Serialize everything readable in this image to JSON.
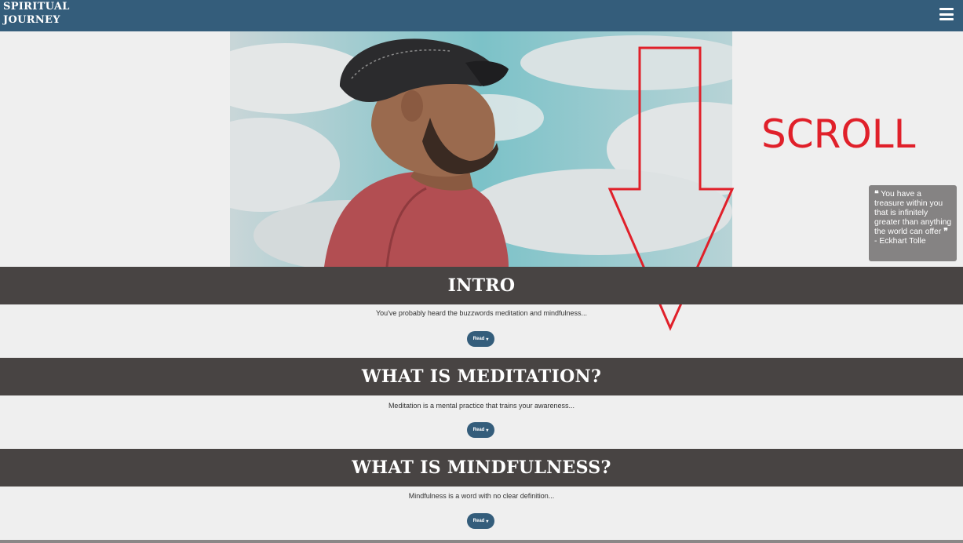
{
  "navbar": {
    "brand_line1": "SPIRITUAL",
    "brand_line2": "JOURNEY",
    "menu_icon": "hamburger-menu-icon",
    "background_color": "#345d7b"
  },
  "annotation": {
    "scroll_text": "SCROLL",
    "arrow_color": "#e0202a"
  },
  "quote": {
    "open_mark": "❝",
    "text": "You have a treasure within you that is infinitely greater than anything the world can offer",
    "close_mark": "❞",
    "author": "- Eckhart Tolle"
  },
  "sections": [
    {
      "title": "INTRO",
      "text": "You've probably heard the buzzwords meditation and mindfulness...",
      "button_label": "Read",
      "button_icon": "caret-down-icon"
    },
    {
      "title": "WHAT IS MEDITATION?",
      "text": "Meditation is a mental practice that trains your awareness...",
      "button_label": "Read",
      "button_icon": "caret-down-icon"
    },
    {
      "title": "WHAT IS MINDFULNESS?",
      "text": "Mindfulness is a word with no clear definition...",
      "button_label": "Read",
      "button_icon": "caret-down-icon"
    }
  ],
  "colors": {
    "section_header": "#484443",
    "page_background": "#efefef",
    "button": "#345d7b"
  }
}
